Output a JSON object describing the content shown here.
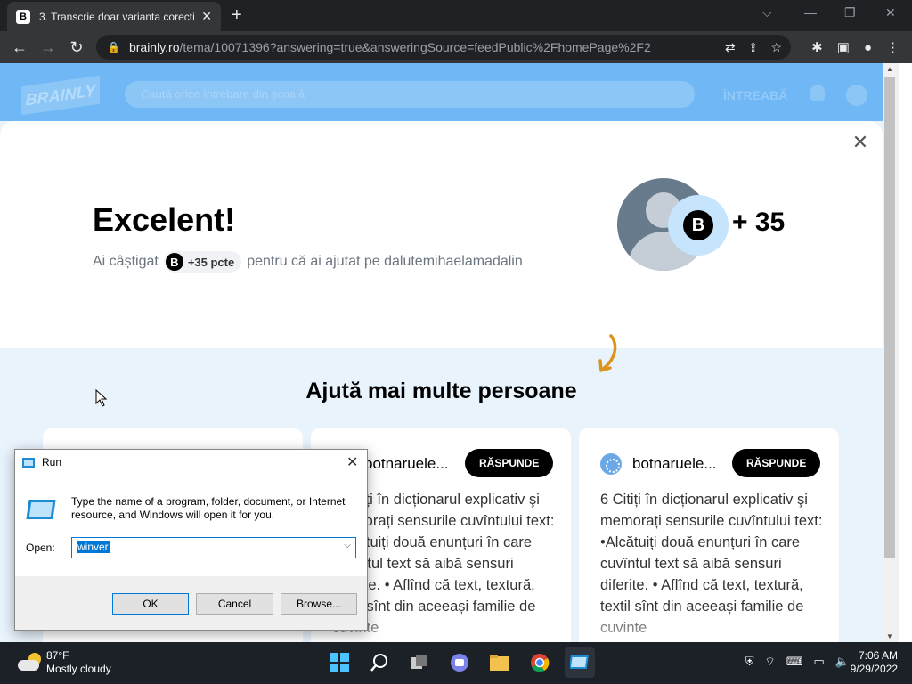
{
  "browser": {
    "tab_title": "3. Transcrie doar varianta corecti",
    "tab_favicon": "B",
    "url_host": "brainly.ro",
    "url_path": "/tema/10071396?answering=true&answeringSource=feedPublic%2FhomePage%2F2"
  },
  "site_header": {
    "logo": "BRAINLY",
    "search_placeholder": "Caută orice întrebare din școală",
    "ask_label": "ÎNTREABĂ"
  },
  "modal": {
    "heading": "Excelent!",
    "earned_prefix": "Ai câștigat",
    "points_badge": "+35 pcte",
    "earned_suffix": "pentru că ai ajutat pe dalutemihaelamadalin",
    "reward": "+ 35",
    "badge_letter": "B"
  },
  "help_more": {
    "heading": "Ajută mai multe persoane",
    "cards": [
      {
        "user": "botnaruele...",
        "button": "RĂSPUNDE",
        "text": "6 Citiți în dicționarul explicativ şi memorați sensurile cuvîntului text: •Alcătuiți două enunțuri în care cuvîntul text să aibă sensuri diferite. • Aflînd că text, textură, textil sînt din aceeași familie de cuvinte"
      },
      {
        "user": "botnaruele...",
        "button": "RĂSPUNDE",
        "text": "6 Citiți în dicționarul explicativ şi memorați sensurile cuvîntului text: •Alcătuiți două enunțuri în care cuvîntul text să aibă sensuri diferite. • Aflînd că text, textură, textil sînt din aceeași familie de cuvinte"
      }
    ]
  },
  "run_dialog": {
    "title": "Run",
    "description": "Type the name of a program, folder, document, or Internet resource, and Windows will open it for you.",
    "open_label": "Open:",
    "input_value": "winver",
    "ok_label": "OK",
    "cancel_label": "Cancel",
    "browse_label": "Browse..."
  },
  "taskbar": {
    "temperature": "87°F",
    "weather": "Mostly cloudy",
    "time": "7:06 AM",
    "date": "9/29/2022"
  }
}
